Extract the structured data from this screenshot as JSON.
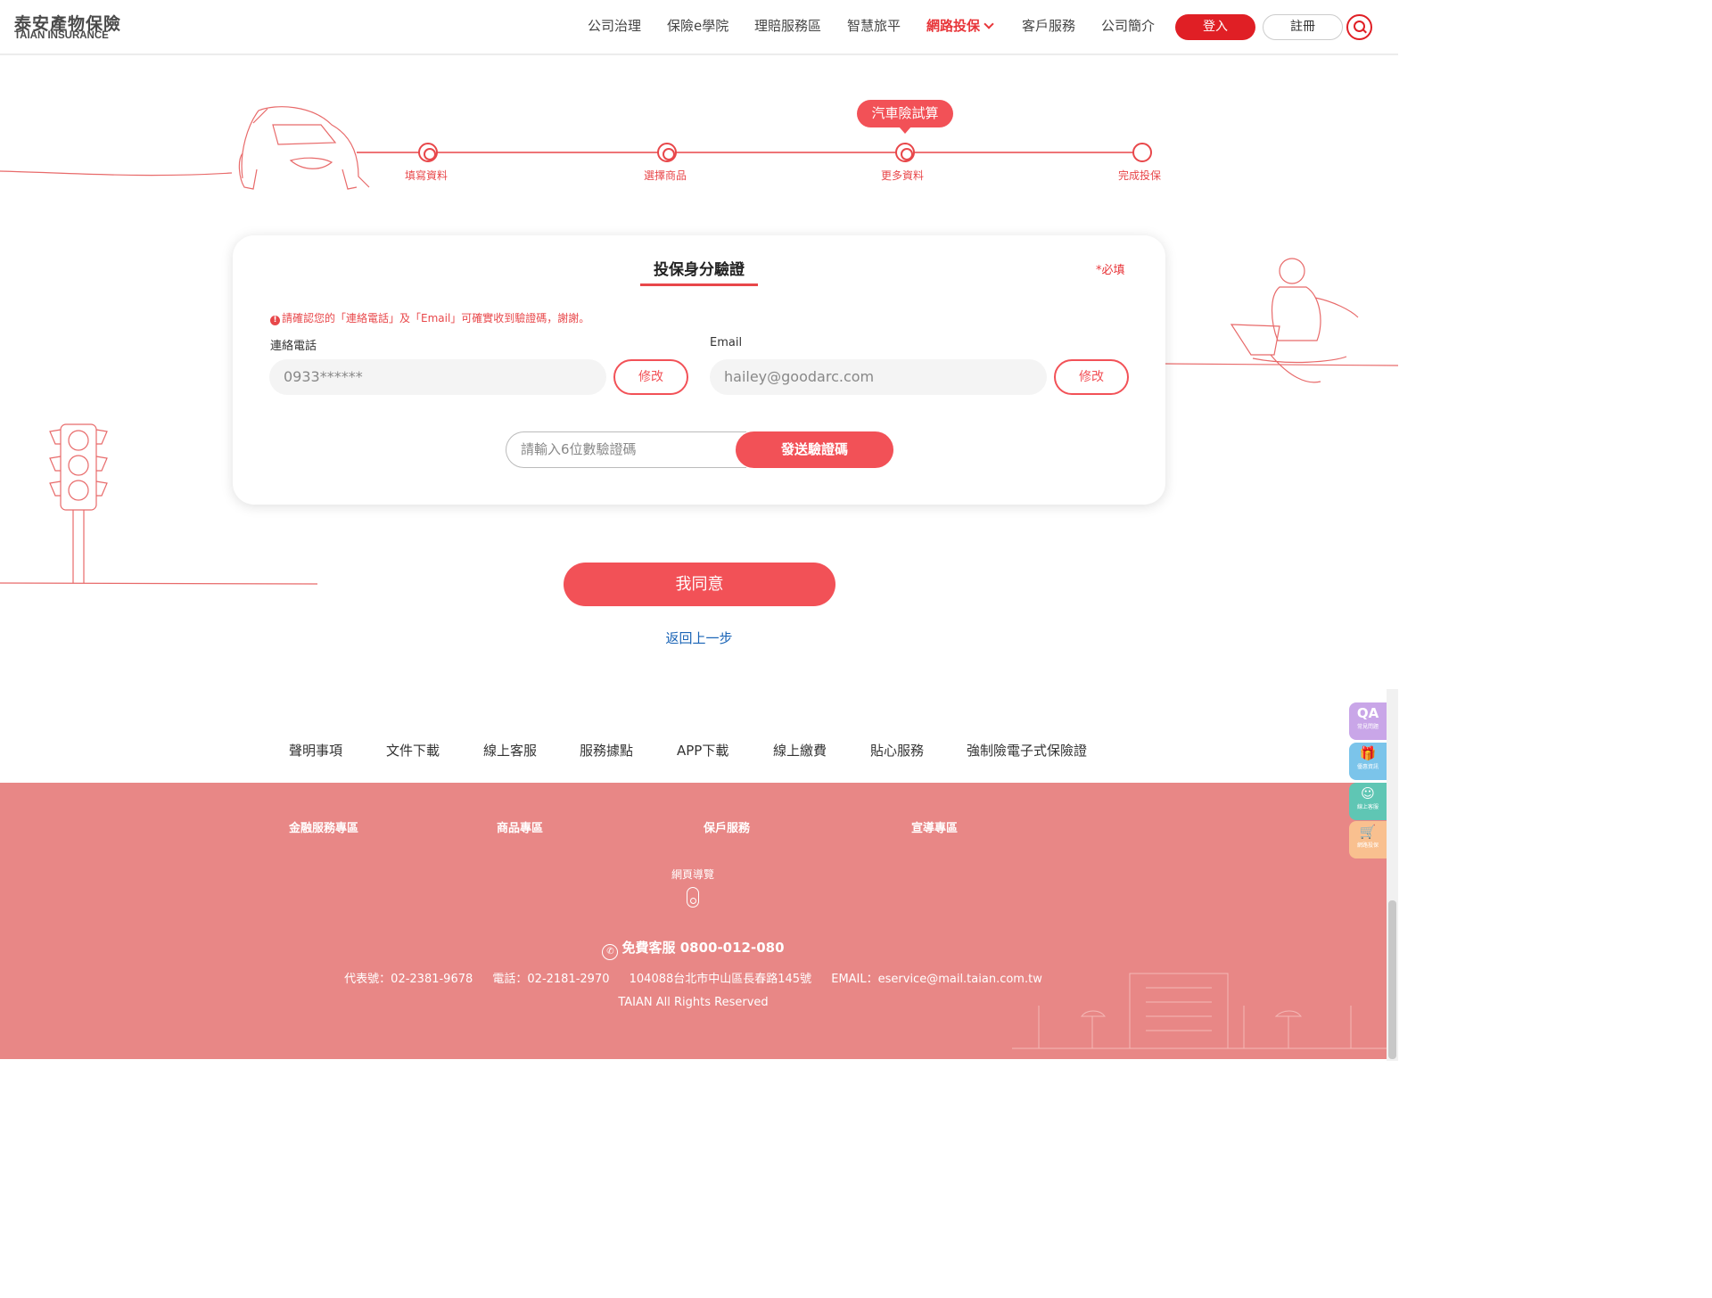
{
  "header": {
    "logo_cn": "泰安產物保險",
    "logo_en": "TAIAN INSURANCE",
    "nav": [
      "公司治理",
      "保險e學院",
      "理賠服務區",
      "智慧旅平",
      "網路投保",
      "客戶服務",
      "公司簡介"
    ],
    "active_nav": "網路投保",
    "login_label": "登入",
    "register_label": "註冊"
  },
  "progress": {
    "tooltip": "汽車險試算",
    "steps": [
      "填寫資料",
      "選擇商品",
      "更多資料",
      "完成投保"
    ],
    "current_step": 3
  },
  "verify": {
    "title": "投保身分驗證",
    "required_note": "*必填",
    "notice": "請確認您的「連絡電話」及「Email」可確實收到驗證碼，謝謝。",
    "phone_label": "連絡電話",
    "phone_value": "0933******",
    "email_label": "Email",
    "email_value": "hailey@goodarc.com",
    "edit_label": "修改",
    "code_placeholder": "請輸入6位數驗證碼",
    "send_label": "發送驗證碼"
  },
  "actions": {
    "agree_label": "我同意",
    "back_label": "返回上一步"
  },
  "footer": {
    "links": [
      "聲明事項",
      "文件下載",
      "線上客服",
      "服務據點",
      "APP下載",
      "線上繳費",
      "貼心服務",
      "強制險電子式保險證"
    ],
    "categories": [
      "金融服務專區",
      "商品專區",
      "保戶服務",
      "宣導專區"
    ],
    "sitemap": "網頁導覽",
    "hotline": "免費客服 0800-012-080",
    "contact": [
      "代表號：02-2381-9678",
      "電話：02-2181-2970",
      "104088台北市中山區長春路145號",
      "EMAIL：eservice@mail.taian.com.tw"
    ],
    "rights": "TAIAN All Rights Reserved",
    "color": "#e88786"
  },
  "side_buttons": [
    {
      "icon": "QA",
      "label": "常見問題",
      "color": "#c9a6e8"
    },
    {
      "icon": "gift-icon",
      "label": "優惠資訊",
      "color": "#7bc4ea"
    },
    {
      "icon": "chat-icon",
      "label": "線上客服",
      "color": "#5fc6b4"
    },
    {
      "icon": "cart-icon",
      "label": "網路投保",
      "color": "#f9c08f"
    }
  ],
  "colors": {
    "accent": "#f25157",
    "brand_red": "#e01f25",
    "link_blue": "#1a64b6"
  }
}
